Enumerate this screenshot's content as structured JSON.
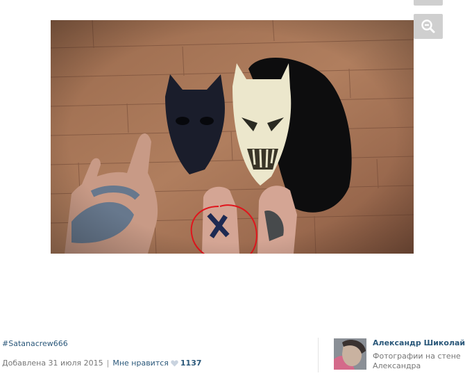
{
  "toolbar": {
    "zoom_icon": "zoom-out-icon"
  },
  "photo": {
    "annotation_color": "#e0151c",
    "description_icon": "photo"
  },
  "post": {
    "hashtag": "#Satanacrew666",
    "added_label": "Добавлена 31 июля 2015",
    "like_label": "Мне нравится",
    "like_count": "1137"
  },
  "author": {
    "name": "Александр Шиколай",
    "album": "Фотографии на стене Александра"
  },
  "colors": {
    "link": "#2b587a",
    "muted": "#777777",
    "button": "#cfcfcf"
  }
}
